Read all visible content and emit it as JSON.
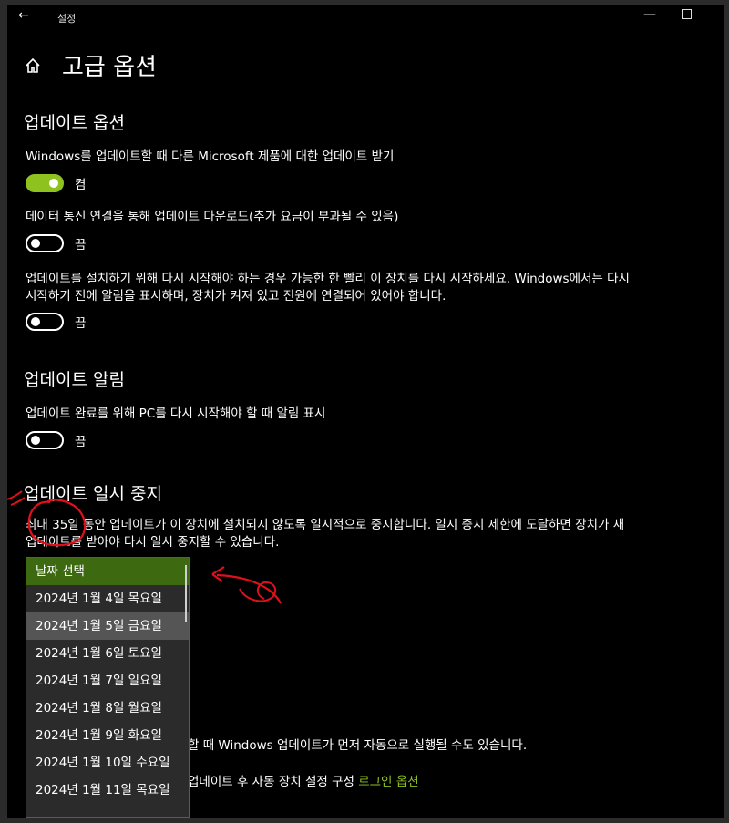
{
  "window": {
    "title": "설정",
    "back_icon": "←",
    "minimize_icon": "—",
    "maximize_icon": "□"
  },
  "page": {
    "title": "고급 옵션",
    "home_icon": "home-icon"
  },
  "update_options": {
    "heading": "업데이트 옵션",
    "ms_products": {
      "label": "Windows를 업데이트할 때 다른 Microsoft 제품에 대한 업데이트 받기",
      "state": "켬"
    },
    "metered": {
      "label": "데이터 통신 연결을 통해 업데이트 다운로드(추가 요금이 부과될 수 있음)",
      "state": "끔"
    },
    "restart_asap": {
      "line1": "업데이트를 설치하기 위해 다시 시작해야 하는 경우 가능한 한 빨리 이 장치를 다시 시작하세요. Windows에서는 다시",
      "line2": "시작하기 전에 알림을 표시하며, 장치가 켜져 있고 전원에 연결되어 있어야 합니다.",
      "state": "끔"
    }
  },
  "notifications": {
    "heading": "업데이트 알림",
    "restart_notice": {
      "label": "업데이트 완료를 위해 PC를 다시 시작해야 할 때 알림 표시",
      "state": "끔"
    }
  },
  "pause": {
    "heading": "업데이트 일시 중지",
    "desc_line1": "최대 35일 동안 업데이트가 이 장치에 설치되지 않도록 일시적으로 중지합니다. 일시 중지 제한에 도달하면 장치가 새",
    "desc_line2": "업데이트를 받아야 다시 일시 중지할 수 있습니다.",
    "dropdown": {
      "options": [
        "날짜 선택",
        "2024년 1월 4일 목요일",
        "2024년 1월 5일 금요일",
        "2024년 1월 6일 토요일",
        "2024년 1월 7일 일요일",
        "2024년 1월 8일 월요일",
        "2024년 1월 9일 화요일",
        "2024년 1월 10일 수요일",
        "2024년 1월 11일 목요일"
      ],
      "selected_index": 0,
      "hover_index": 2
    }
  },
  "below": {
    "line1": "할 때 Windows 업데이트가 먼저 자동으로 실행될 수도 있습니다.",
    "line2_text": "업데이트 후 자동 장치 설정 구성",
    "line2_link": "로그인 옵션"
  },
  "colors": {
    "accent": "#8dc21f",
    "selected": "#3d6a10",
    "annotation": "#e0101a"
  }
}
